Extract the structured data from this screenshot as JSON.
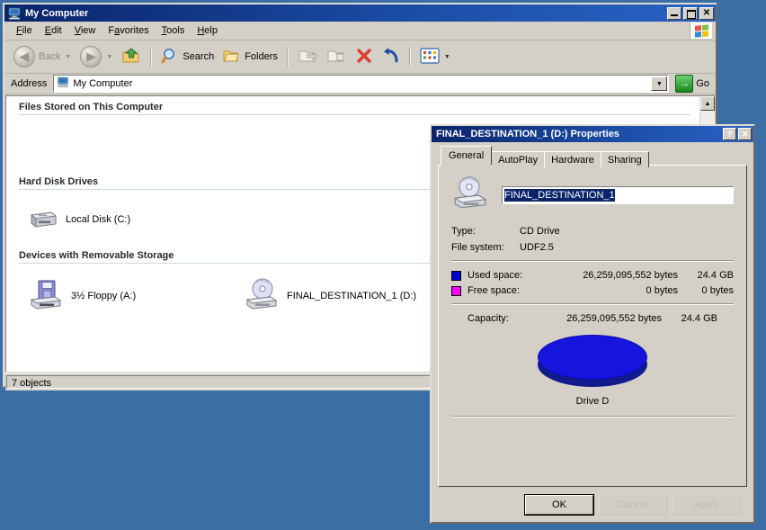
{
  "desktop": {
    "background_color": "#3b6ea5"
  },
  "explorer": {
    "title": "My Computer",
    "title_icon": "my-computer-icon",
    "window_buttons": {
      "minimize": "_",
      "maximize": "□",
      "close": "✕"
    },
    "menu": [
      {
        "label": "File",
        "accel": "F"
      },
      {
        "label": "Edit",
        "accel": "E"
      },
      {
        "label": "View",
        "accel": "V"
      },
      {
        "label": "Favorites",
        "accel": "a"
      },
      {
        "label": "Tools",
        "accel": "T"
      },
      {
        "label": "Help",
        "accel": "H"
      }
    ],
    "toolbar": {
      "back": "Back",
      "search": "Search",
      "folders": "Folders",
      "move_to": "Move To",
      "copy_to": "Copy To",
      "delete": "Delete",
      "undo": "Undo",
      "views": "Views"
    },
    "address": {
      "label": "Address",
      "value": "My Computer",
      "go_label": "Go"
    },
    "groups": [
      {
        "heading": "Files Stored on This Computer",
        "items": []
      },
      {
        "heading": "Hard Disk Drives",
        "items": [
          {
            "label": "Local Disk (C:)",
            "icon": "hard-disk-icon"
          }
        ]
      },
      {
        "heading": "Devices with Removable Storage",
        "items": [
          {
            "label": "3½ Floppy (A:)",
            "icon": "floppy-drive-icon"
          },
          {
            "label": "FINAL_DESTINATION_1 (D:)",
            "icon": "cd-drive-icon"
          }
        ]
      }
    ],
    "status": "7 objects"
  },
  "properties_dialog": {
    "title": "FINAL_DESTINATION_1 (D:) Properties",
    "help_button": "?",
    "close_button": "✕",
    "tabs": [
      {
        "label": "General",
        "active": true
      },
      {
        "label": "AutoPlay",
        "active": false
      },
      {
        "label": "Hardware",
        "active": false
      },
      {
        "label": "Sharing",
        "active": false
      }
    ],
    "volume": {
      "icon": "cd-drive-icon",
      "label_value": "FINAL_DESTINATION_1"
    },
    "info": [
      {
        "key": "Type:",
        "value": "CD Drive"
      },
      {
        "key": "File system:",
        "value": "UDF2.5"
      }
    ],
    "space": [
      {
        "swatch_color": "#0000cc",
        "key": "Used space:",
        "bytes": "26,259,095,552 bytes",
        "gb": "24.4 GB"
      },
      {
        "swatch_color": "#ff00ff",
        "key": "Free space:",
        "bytes": "0 bytes",
        "gb": "0 bytes"
      }
    ],
    "capacity": {
      "key": "Capacity:",
      "bytes": "26,259,095,552 bytes",
      "gb": "24.4 GB"
    },
    "pie_caption": "Drive D",
    "buttons": {
      "ok": "OK",
      "cancel": "Cancel",
      "apply": "Apply"
    }
  },
  "chart_data": {
    "type": "pie",
    "title": "Drive D",
    "categories": [
      "Used space",
      "Free space"
    ],
    "values": [
      26259095552,
      0
    ],
    "value_labels": [
      "26,259,095,552 bytes",
      "0 bytes"
    ],
    "percentages": [
      100,
      0
    ],
    "colors": [
      "#0000cc",
      "#ff00ff"
    ],
    "legend_position": "above",
    "units": "bytes"
  }
}
